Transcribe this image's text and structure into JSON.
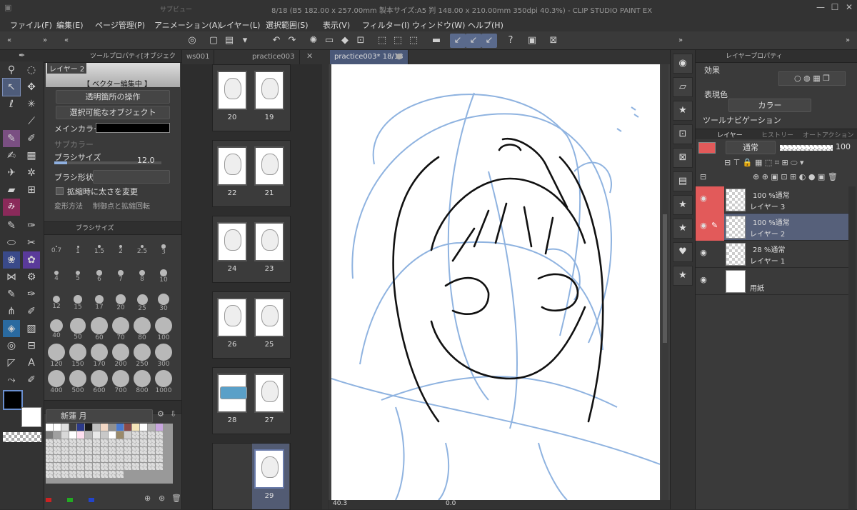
{
  "title_bar": {
    "mini_label": "サブビュー",
    "title": "8/18 (B5 182.00 x 257.00mm 製本サイズ:A5 判 148.00 x 210.00mm 350dpi 40.3%) - CLIP STUDIO PAINT EX",
    "minimize": "—",
    "maximize": "☐",
    "close": "✕"
  },
  "menu": [
    "ファイル(F)",
    "編集(E)",
    "ページ管理(P)",
    "アニメーション(A)",
    "レイヤー(L)",
    "選択範囲(S)",
    "表示(V)",
    "フィルター(I)",
    "ウィンドウ(W)",
    "ヘルプ(H)"
  ],
  "tool_property": {
    "header": "ツールプロパティ[オブジェクト]",
    "layer_label": "レイヤー 2",
    "vector_mode": "【 ベクター編集中 】",
    "transparent_ops": "透明箇所の操作",
    "selectable_objects": "選択可能なオブジェクト",
    "main_color_label": "メインカラー",
    "sub_color_label": "サブカラー",
    "brush_size_label": "ブラシサイズ",
    "brush_size_value": "12.0",
    "brush_shape_label": "ブラシ形状",
    "scale_thickness_label": "拡縮時に太さを変更",
    "transform_label": "変形方法",
    "transform_value": "制御点と拡縮回転"
  },
  "brush_size_panel": {
    "header": "ブラシサイズ",
    "sizes": [
      "0.7",
      "1",
      "1.5",
      "2",
      "2.5",
      "3",
      "4",
      "5",
      "6",
      "7",
      "8",
      "10",
      "12",
      "15",
      "17",
      "20",
      "25",
      "30",
      "40",
      "50",
      "60",
      "70",
      "80",
      "100",
      "120",
      "150",
      "170",
      "200",
      "250",
      "300",
      "400",
      "500",
      "600",
      "700",
      "800",
      "1000"
    ]
  },
  "color_set": {
    "name": "新蓮 月",
    "swatches": [
      "#ffffff",
      "#ffffff",
      "#e0e0e0",
      "#404040",
      "#2c3a8a",
      "#1a1a1a",
      "#c0c0c0",
      "#f2d7c4",
      "#8f8f8f",
      "#4a7ad0",
      "#8a4a4a",
      "#f4e4b8",
      "#ffffff",
      "#b0b0b0",
      "#c9a6e0",
      "#7a7a7a",
      "#a0a0a0",
      "#d8d8d8",
      "#ffffff",
      "#ffe0f0",
      "#b8b8b8",
      "#e8e8e8",
      "#c8c8c8",
      "#ffffff",
      "#9a8a6a",
      "#d0d0d0"
    ],
    "channel_colors": [
      "#cc2222",
      "#22aa22",
      "#2244cc"
    ]
  },
  "page_manager": {
    "tabs": [
      "ws001",
      "practice003"
    ],
    "pages": [
      {
        "left": "20",
        "right": "19"
      },
      {
        "left": "22",
        "right": "21"
      },
      {
        "left": "24",
        "right": "23"
      },
      {
        "left": "26",
        "right": "25"
      },
      {
        "left": "28",
        "right": "27"
      },
      {
        "left": "",
        "right": "29"
      }
    ]
  },
  "canvas": {
    "tab_label": "practice003* 18/18",
    "zoom": "40.3",
    "angle": "0.0"
  },
  "layer_property": {
    "header": "レイヤープロパティ",
    "effect_label": "効果",
    "expression_color_label": "表現色",
    "expression_color_value": "カラー",
    "navigation_label": "ツールナビゲーション"
  },
  "layer_panel": {
    "tabs": [
      "レイヤー",
      "ヒストリー",
      "オートアクション"
    ],
    "blend_mode": "通常",
    "opacity": "100",
    "layers": [
      {
        "mode": "100 %通常",
        "name": "レイヤー 3",
        "selected": false,
        "red": true
      },
      {
        "mode": "100 %通常",
        "name": "レイヤー 2",
        "selected": true,
        "red": true
      },
      {
        "mode": "28 %通常",
        "name": "レイヤー 1",
        "selected": false,
        "red": false
      },
      {
        "mode": "",
        "name": "用紙",
        "selected": false,
        "red": false
      }
    ]
  },
  "colors": {
    "accent": "#4a5878",
    "layer_selected": "#56607a",
    "red_marker": "#e25a5a",
    "main_color": "#000000",
    "sub_color": "#ffffff",
    "sketch_blue": "#8fb3e0"
  }
}
